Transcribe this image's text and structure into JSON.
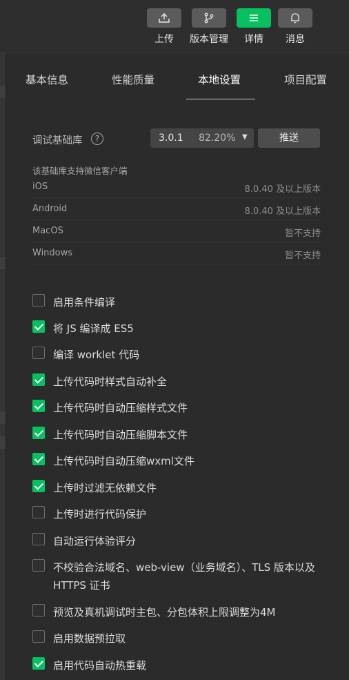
{
  "toolbar": {
    "buttons": [
      {
        "label": "上传",
        "icon": "upload-icon",
        "active": false
      },
      {
        "label": "版本管理",
        "icon": "branch-icon",
        "active": false
      },
      {
        "label": "详情",
        "icon": "menu-icon",
        "active": true
      },
      {
        "label": "消息",
        "icon": "bell-icon",
        "active": false
      }
    ]
  },
  "tabs": [
    {
      "label": "基本信息"
    },
    {
      "label": "性能质量"
    },
    {
      "label": "本地设置"
    },
    {
      "label": "项目配置"
    }
  ],
  "library": {
    "label": "调试基础库",
    "version": "3.0.1",
    "percent": "82.20%",
    "push_label": "推送"
  },
  "support": {
    "title": "该基础库支持微信客户端",
    "rows": [
      {
        "name": "iOS",
        "value": "8.0.40 及以上版本"
      },
      {
        "name": "Android",
        "value": "8.0.40 及以上版本"
      },
      {
        "name": "MacOS",
        "value": "暂不支持"
      },
      {
        "name": "Windows",
        "value": "暂不支持"
      }
    ]
  },
  "options": [
    {
      "label": "启用条件编译",
      "checked": false
    },
    {
      "label": "将 JS 编译成 ES5",
      "checked": true
    },
    {
      "label": "编译 worklet 代码",
      "checked": false
    },
    {
      "label": "上传代码时样式自动补全",
      "checked": true
    },
    {
      "label": "上传代码时自动压缩样式文件",
      "checked": true
    },
    {
      "label": "上传代码时自动压缩脚本文件",
      "checked": true
    },
    {
      "label": "上传代码时自动压缩wxml文件",
      "checked": true
    },
    {
      "label": "上传时过滤无依赖文件",
      "checked": true
    },
    {
      "label": "上传时进行代码保护",
      "checked": false
    },
    {
      "label": "自动运行体验评分",
      "checked": false
    },
    {
      "label": "不校验合法域名、web-view（业务域名）、TLS 版本以及 HTTPS 证书",
      "checked": false
    },
    {
      "label": "预览及真机调试时主包、分包体积上限调整为4M",
      "checked": false
    },
    {
      "label": "启用数据预拉取",
      "checked": false
    },
    {
      "label": "启用代码自动热重载",
      "checked": true
    }
  ],
  "colors": {
    "accent": "#07c160",
    "background": "#2b2b2b"
  }
}
